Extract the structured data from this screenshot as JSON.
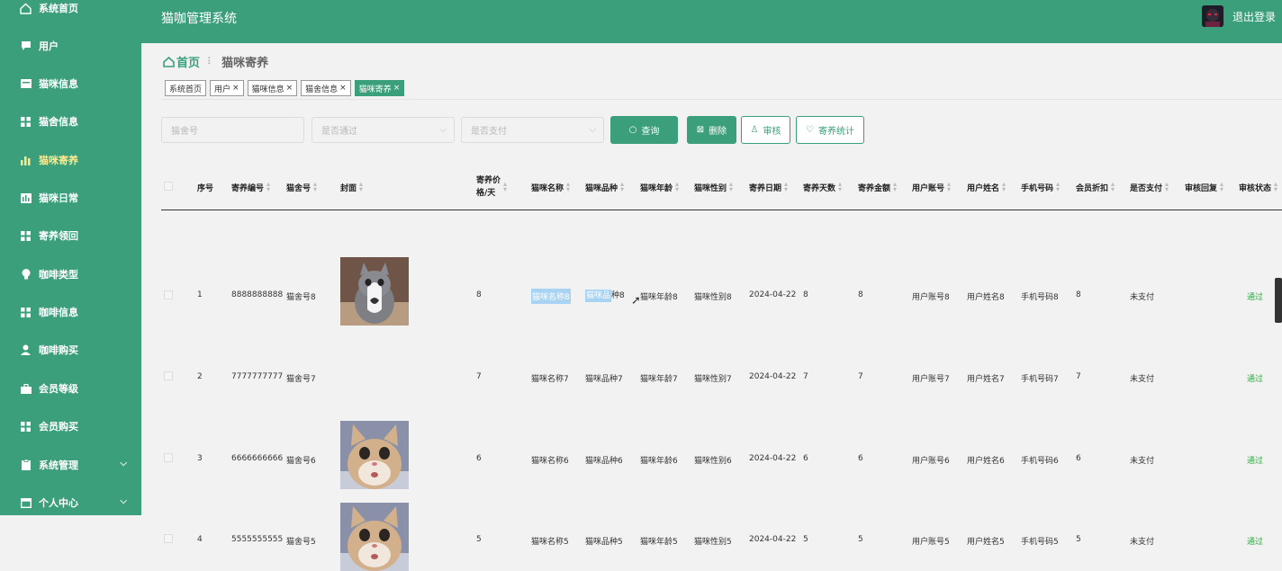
{
  "app": {
    "title": "猫咖管理系统",
    "logout": "退出登录"
  },
  "sidebar": {
    "items": [
      {
        "label": "系统首页",
        "icon": "home-icon"
      },
      {
        "label": "用户",
        "icon": "chat-icon"
      },
      {
        "label": "猫咪信息",
        "icon": "card-icon"
      },
      {
        "label": "猫舍信息",
        "icon": "grid-icon"
      },
      {
        "label": "猫咪寄养",
        "icon": "bar-chart-icon"
      },
      {
        "label": "猫咪日常",
        "icon": "column-chart-icon"
      },
      {
        "label": "寄养领回",
        "icon": "grid-icon"
      },
      {
        "label": "咖啡类型",
        "icon": "bulb-icon"
      },
      {
        "label": "咖啡信息",
        "icon": "grid-icon"
      },
      {
        "label": "咖啡购买",
        "icon": "user-icon"
      },
      {
        "label": "会员等级",
        "icon": "briefcase-icon"
      },
      {
        "label": "会员购买",
        "icon": "grid-icon"
      },
      {
        "label": "系统管理",
        "icon": "clipboard-icon"
      },
      {
        "label": "个人中心",
        "icon": "window-icon"
      }
    ]
  },
  "breadcrumb": {
    "home": "首页",
    "sep": "⠇",
    "current": "猫咪寄养"
  },
  "tags": [
    {
      "label": "系统首页",
      "closable": false
    },
    {
      "label": "用户",
      "closable": true
    },
    {
      "label": "猫咪信息",
      "closable": true
    },
    {
      "label": "猫舍信息",
      "closable": true
    },
    {
      "label": "猫咪寄养",
      "closable": true
    }
  ],
  "search": {
    "cattery_placeholder": "猫舍号",
    "passed_placeholder": "是否通过",
    "paid_placeholder": "是否支付",
    "query": "查询",
    "delete": "删除",
    "review": "审核",
    "stats": "寄养统计"
  },
  "table": {
    "headers": [
      "序号",
      "寄养编号",
      "猫舍号",
      "封面",
      "寄养价格/天",
      "猫咪名称",
      "猫咪品种",
      "猫咪年龄",
      "猫咪性别",
      "寄养日期",
      "寄养天数",
      "寄养金额",
      "用户账号",
      "用户姓名",
      "手机号码",
      "会员折扣",
      "是否支付",
      "审核回复",
      "审核状态"
    ],
    "header_price_line1": "寄养价",
    "header_price_line2": "格/天",
    "rows": [
      {
        "idx": "1",
        "no": "8888888888",
        "cattery": "猫舍号8",
        "cover": "cat-photo-1",
        "price": "8",
        "name": "猫咪名称8",
        "breed_a": "猫咪品",
        "breed_b": "种8",
        "age": "猫咪年龄8",
        "sex": "猫咪性别8",
        "date": "2024-04-22",
        "days": "8",
        "amount": "8",
        "account": "用户账号8",
        "uname": "用户姓名8",
        "phone": "手机号码8",
        "discount": "8",
        "paid": "未支付",
        "reply": "",
        "status": "通过"
      },
      {
        "idx": "2",
        "no": "7777777777",
        "cattery": "猫舍号7",
        "cover": "",
        "price": "7",
        "name": "猫咪名称7",
        "breed_a": "猫咪品种7",
        "breed_b": "",
        "age": "猫咪年龄7",
        "sex": "猫咪性别7",
        "date": "2024-04-22",
        "days": "7",
        "amount": "7",
        "account": "用户账号7",
        "uname": "用户姓名7",
        "phone": "手机号码7",
        "discount": "7",
        "paid": "未支付",
        "reply": "",
        "status": "通过"
      },
      {
        "idx": "3",
        "no": "6666666666",
        "cattery": "猫舍号6",
        "cover": "cat-photo-2",
        "price": "6",
        "name": "猫咪名称6",
        "breed_a": "猫咪品种6",
        "breed_b": "",
        "age": "猫咪年龄6",
        "sex": "猫咪性别6",
        "date": "2024-04-22",
        "days": "6",
        "amount": "6",
        "account": "用户账号6",
        "uname": "用户姓名6",
        "phone": "手机号码6",
        "discount": "6",
        "paid": "未支付",
        "reply": "",
        "status": "通过"
      },
      {
        "idx": "4",
        "no": "5555555555",
        "cattery": "猫舍号5",
        "cover": "cat-photo-2",
        "price": "5",
        "name": "猫咪名称5",
        "breed_a": "猫咪品种5",
        "breed_b": "",
        "age": "猫咪年龄5",
        "sex": "猫咪性别5",
        "date": "2024-04-22",
        "days": "5",
        "amount": "5",
        "account": "用户账号5",
        "uname": "用户姓名5",
        "phone": "手机号码5",
        "discount": "5",
        "paid": "未支付",
        "reply": "",
        "status": "通过"
      }
    ]
  },
  "colors": {
    "primary": "#3c9f7c",
    "pass": "#3aa64b",
    "highlight": "#ffe98a"
  }
}
